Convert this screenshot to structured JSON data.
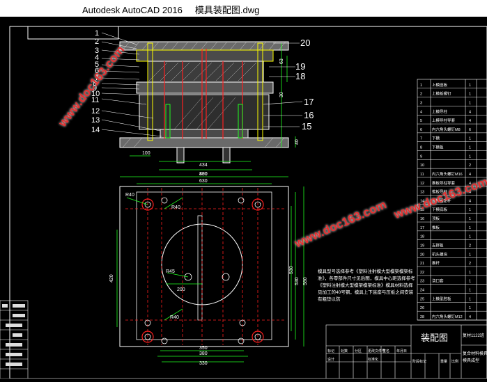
{
  "window": {
    "title": "Autodesk AutoCAD 2016     模具装配图.dwg"
  },
  "callouts": [
    "1",
    "2",
    "3",
    "4",
    "5",
    "6",
    "7",
    "8",
    "9",
    "10",
    "11",
    "12",
    "13",
    "14",
    "15",
    "16",
    "17",
    "18",
    "19",
    "20"
  ],
  "front_dims": {
    "d434": "434",
    "d430": "430",
    "d100": "100",
    "d63": "63",
    "d30": "30",
    "d40": "40"
  },
  "top_dims": {
    "d800": "800",
    "d630": "630",
    "d420": "420",
    "d200": "200",
    "d530": "530",
    "d580": "580",
    "d350": "350",
    "d380": "380",
    "d330": "330",
    "r40a": "R40",
    "r40b": "R40",
    "r45": "R45",
    "r40c": "R40",
    "d530r": "530"
  },
  "note": "模具型号选择参考《塑料注射模大型模架模架标准》，各零部件尺寸见后图，模具中心距选择参考《塑料注射模大型模架模架标准》模具材料选择见加工的40号钢，模具上下底座与压板之间安装有粗垫以防",
  "watermarks": [
    "www.doc163.com",
    "www.doc163.com",
    "www.doc163.com"
  ],
  "parts_table": [
    {
      "no": "1",
      "name": "上模座板",
      "qty": "1"
    },
    {
      "no": "2",
      "name": "上模板螺钉",
      "qty": "1"
    },
    {
      "no": "3",
      "name": "",
      "qty": "1"
    },
    {
      "no": "4",
      "name": "上模导柱",
      "qty": "4"
    },
    {
      "no": "5",
      "name": "上模导柱导套",
      "qty": "4"
    },
    {
      "no": "6",
      "name": "内六角头螺钉M8",
      "qty": "6"
    },
    {
      "no": "7",
      "name": "下模",
      "qty": "1"
    },
    {
      "no": "8",
      "name": "下模板",
      "qty": "1"
    },
    {
      "no": "9",
      "name": "",
      "qty": "1"
    },
    {
      "no": "10",
      "name": "",
      "qty": "2"
    },
    {
      "no": "11",
      "name": "内六角头螺钉M16",
      "qty": "4"
    },
    {
      "no": "12",
      "name": "推板导柱导套",
      "qty": "4"
    },
    {
      "no": "13",
      "name": "推板导柱",
      "qty": "4"
    },
    {
      "no": "14",
      "name": "顶杆固定杆",
      "qty": "4"
    },
    {
      "no": "15",
      "name": "下模底板",
      "qty": "1"
    },
    {
      "no": "16",
      "name": "顶板",
      "qty": "1"
    },
    {
      "no": "17",
      "name": "推板",
      "qty": "1"
    },
    {
      "no": "18",
      "name": "",
      "qty": "1"
    },
    {
      "no": "19",
      "name": "支撑板",
      "qty": "2"
    },
    {
      "no": "20",
      "name": "机头模块",
      "qty": "1"
    },
    {
      "no": "21",
      "name": "推杆",
      "qty": "2"
    },
    {
      "no": "22",
      "name": "",
      "qty": "1"
    },
    {
      "no": "23",
      "name": "浇口套",
      "qty": "1"
    },
    {
      "no": "24",
      "name": "",
      "qty": "1"
    },
    {
      "no": "25",
      "name": "上模型腔板",
      "qty": "1"
    },
    {
      "no": "26",
      "name": "",
      "qty": "1"
    },
    {
      "no": "28",
      "name": "内六角头螺钉M12",
      "qty": "4"
    }
  ],
  "title_block": {
    "drawing_name": "装配图",
    "right_top": "复材1122班",
    "right_bottom": "复合材料模具设计",
    "right_bottom2": "模具成型",
    "hdr": [
      "标记",
      "处数",
      "分区",
      "更改文件号",
      "签名",
      "年月日"
    ],
    "row2": [
      "设计",
      "",
      "标准化"
    ],
    "stage": [
      "阶段标记",
      "重量",
      "比例"
    ]
  },
  "left_block": [
    "",
    "",
    "",
    "",
    "",
    ""
  ]
}
